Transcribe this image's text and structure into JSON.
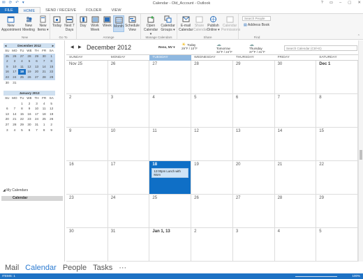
{
  "window": {
    "title": "Calendar - Old_Account - Outlook",
    "controls": [
      "?",
      "▭",
      "–",
      "▢",
      "✕"
    ]
  },
  "quick_access": [
    "envelope-icon",
    "sync-icon",
    "undo-icon",
    "dropdown-icon"
  ],
  "ribbon_tabs": [
    "FILE",
    "HOME",
    "SEND / RECEIVE",
    "FOLDER",
    "VIEW"
  ],
  "ribbon": {
    "new_appointment": "New Appointment",
    "new_meeting": "New Meeting",
    "new_items": "New Items ▾",
    "today": "Today",
    "next7": "Next 7 Days",
    "day": "Day",
    "work_week": "Work Week",
    "week": "Week",
    "month": "Month",
    "schedule_view": "Schedule View",
    "open_calendar": "Open Calendar ▾",
    "calendar_groups": "Calendar Groups ▾",
    "email_calendar": "E-mail Calendar",
    "share_calendar": "Share Calendar",
    "publish_online": "Publish Online ▾",
    "calendar_permissions": "Calendar Permissions",
    "search_people": "Search People",
    "address_book": "Address Book",
    "groups": {
      "new": "New",
      "goto": "Go To",
      "arrange": "Arrange",
      "manage": "Manage Calendars",
      "share": "Share",
      "find": "Find"
    }
  },
  "mini_calendars": [
    {
      "title": "December 2012",
      "dow": [
        "SU",
        "MO",
        "TU",
        "WE",
        "TH",
        "FR",
        "SA"
      ],
      "days": [
        "25",
        "26",
        "27",
        "28",
        "29",
        "30",
        "1",
        "2",
        "3",
        "4",
        "5",
        "6",
        "7",
        "8",
        "9",
        "10",
        "11",
        "12",
        "13",
        "14",
        "15",
        "16",
        "17",
        "18",
        "19",
        "20",
        "21",
        "22",
        "23",
        "24",
        "25",
        "26",
        "27",
        "28",
        "29",
        "30",
        "31",
        "",
        "",
        "",
        "",
        ""
      ],
      "today": "18"
    },
    {
      "title": "January 2013",
      "dow": [
        "SU",
        "MO",
        "TU",
        "WE",
        "TH",
        "FR",
        "SA"
      ],
      "days": [
        "",
        "",
        "1",
        "2",
        "3",
        "4",
        "5",
        "6",
        "7",
        "8",
        "9",
        "10",
        "11",
        "12",
        "13",
        "14",
        "15",
        "16",
        "17",
        "18",
        "19",
        "20",
        "21",
        "22",
        "23",
        "24",
        "25",
        "26",
        "27",
        "28",
        "29",
        "30",
        "31",
        "1",
        "2",
        "3",
        "4",
        "5",
        "6",
        "7",
        "8",
        "9"
      ]
    }
  ],
  "my_calendars": {
    "heading": "◢ My Calendars",
    "items": [
      "Calendar"
    ]
  },
  "calendar": {
    "month_title": "December 2012",
    "location": "Reno, NV ▾",
    "weather": [
      {
        "label": "Today",
        "temp": "29°F / 10°F",
        "icon": "sun-icon"
      },
      {
        "label": "Tomorrow",
        "temp": "32°F / 24°F",
        "icon": "cloud-icon"
      },
      {
        "label": "Thursday",
        "temp": "37°F / 31°F",
        "icon": "cloud-icon"
      }
    ],
    "search_placeholder": "Search Calendar (Ctrl+E)",
    "days_of_week": [
      "SUNDAY",
      "MONDAY",
      "TUESDAY",
      "WEDNESDAY",
      "THURSDAY",
      "FRIDAY",
      "SATURDAY"
    ],
    "current_dow_index": 2,
    "weeks": [
      [
        "Nov 25",
        "26",
        "27",
        "28",
        "29",
        "30",
        "Dec 1"
      ],
      [
        "2",
        "3",
        "4",
        "5",
        "6",
        "7",
        "8"
      ],
      [
        "9",
        "10",
        "11",
        "12",
        "13",
        "14",
        "15"
      ],
      [
        "16",
        "17",
        "18",
        "19",
        "20",
        "21",
        "22"
      ],
      [
        "23",
        "24",
        "25",
        "26",
        "27",
        "28",
        "29"
      ],
      [
        "30",
        "31",
        "Jan 1, 13",
        "2",
        "3",
        "4",
        "5"
      ]
    ],
    "selected_day": "18",
    "appointment": {
      "text": "12:00pm Lunch with Mom",
      "day": "18"
    }
  },
  "nav": [
    "Mail",
    "Calendar",
    "People",
    "Tasks",
    "···"
  ],
  "nav_active": "Calendar",
  "status": {
    "items": "ITEMS: 1",
    "zoom": "100%"
  },
  "colors": {
    "accent": "#1e72c4",
    "selected_day": "#0f6fc6",
    "highlight": "#c5d9ef"
  }
}
